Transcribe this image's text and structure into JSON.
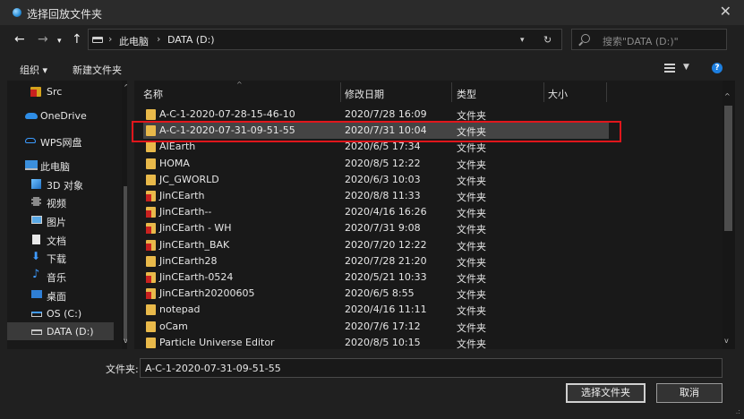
{
  "window": {
    "title": "选择回放文件夹"
  },
  "address": {
    "crumbs": [
      "此电脑",
      "DATA (D:)"
    ],
    "search_placeholder": "搜索\"DATA (D:)\""
  },
  "toolbar": {
    "organize": "组织 ▾",
    "new_folder": "新建文件夹"
  },
  "nav": {
    "items": [
      {
        "label": "Src",
        "icon": "app-icon"
      },
      {
        "label": "OneDrive",
        "icon": "cloud-icon"
      },
      {
        "label": "WPS网盘",
        "icon": "cloud-outline-icon"
      },
      {
        "label": "此电脑",
        "icon": "computer-icon"
      },
      {
        "label": "3D 对象",
        "icon": "cube-icon"
      },
      {
        "label": "视频",
        "icon": "video-icon"
      },
      {
        "label": "图片",
        "icon": "picture-icon"
      },
      {
        "label": "文档",
        "icon": "document-icon"
      },
      {
        "label": "下载",
        "icon": "download-icon"
      },
      {
        "label": "音乐",
        "icon": "music-icon"
      },
      {
        "label": "桌面",
        "icon": "desktop-icon"
      },
      {
        "label": "OS (C:)",
        "icon": "drive-icon"
      },
      {
        "label": "DATA (D:)",
        "icon": "drive-icon"
      }
    ]
  },
  "columns": {
    "name": "名称",
    "modified": "修改日期",
    "type": "类型",
    "size": "大小"
  },
  "files": [
    {
      "name": "A-C-1-2020-07-28-15-46-10",
      "date": "2020/7/28 16:09",
      "type": "文件夹",
      "icon": "folder-icon"
    },
    {
      "name": "A-C-1-2020-07-31-09-51-55",
      "date": "2020/7/31 10:04",
      "type": "文件夹",
      "icon": "folder-icon"
    },
    {
      "name": "AIEarth",
      "date": "2020/6/5 17:34",
      "type": "文件夹",
      "icon": "folder-icon"
    },
    {
      "name": "HOMA",
      "date": "2020/8/5 12:22",
      "type": "文件夹",
      "icon": "folder-icon"
    },
    {
      "name": "JC_GWORLD",
      "date": "2020/6/3 10:03",
      "type": "文件夹",
      "icon": "folder-icon"
    },
    {
      "name": "JinCEarth",
      "date": "2020/8/8 11:33",
      "type": "文件夹",
      "icon": "app-folder-icon"
    },
    {
      "name": "JinCEarth--",
      "date": "2020/4/16 16:26",
      "type": "文件夹",
      "icon": "app-folder-icon"
    },
    {
      "name": "JinCEarth - WH",
      "date": "2020/7/31 9:08",
      "type": "文件夹",
      "icon": "app-folder-icon"
    },
    {
      "name": "JinCEarth_BAK",
      "date": "2020/7/20 12:22",
      "type": "文件夹",
      "icon": "app-folder-icon"
    },
    {
      "name": "JinCEarth28",
      "date": "2020/7/28 21:20",
      "type": "文件夹",
      "icon": "folder-icon"
    },
    {
      "name": "JinCEarth-0524",
      "date": "2020/5/21 10:33",
      "type": "文件夹",
      "icon": "app-folder-icon"
    },
    {
      "name": "JinCEarth20200605",
      "date": "2020/6/5 8:55",
      "type": "文件夹",
      "icon": "app-folder-icon"
    },
    {
      "name": "notepad",
      "date": "2020/4/16 11:11",
      "type": "文件夹",
      "icon": "folder-icon"
    },
    {
      "name": "oCam",
      "date": "2020/7/6 17:12",
      "type": "文件夹",
      "icon": "folder-icon"
    },
    {
      "name": "Particle Universe Editor",
      "date": "2020/8/5 10:15",
      "type": "文件夹",
      "icon": "folder-icon"
    }
  ],
  "footer": {
    "folder_label": "文件夹:",
    "folder_value": "A-C-1-2020-07-31-09-51-55",
    "select_button": "选择文件夹",
    "cancel_button": "取消"
  }
}
